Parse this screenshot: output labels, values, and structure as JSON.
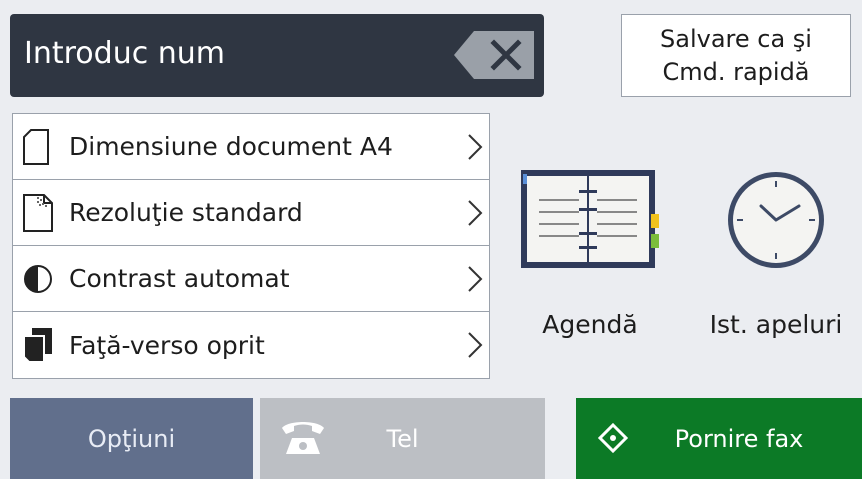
{
  "input": {
    "text": "Introduc num"
  },
  "save_shortcut": {
    "line1": "Salvare ca şi",
    "line2": "Cmd. rapidă"
  },
  "settings": [
    {
      "icon": "document-size-icon",
      "label": "Dimensiune document A4"
    },
    {
      "icon": "resolution-icon",
      "label": "Rezoluţie standard"
    },
    {
      "icon": "contrast-icon",
      "label": "Contrast automat"
    },
    {
      "icon": "duplex-icon",
      "label": "Faţă-verso oprit"
    }
  ],
  "shortcuts": {
    "address_book": {
      "icon": "address-book-icon",
      "label": "Agendă"
    },
    "call_history": {
      "icon": "clock-icon",
      "label": "Ist. apeluri"
    }
  },
  "bottom": {
    "options_label": "Opţiuni",
    "tel_label": "Tel",
    "start_label": "Pornire fax"
  },
  "colors": {
    "input_bg": "#2f3642",
    "options_bg": "#616f8c",
    "tel_bg": "#bcbfc4",
    "start_bg": "#0c7a26",
    "page_bg": "#ebedf1"
  }
}
